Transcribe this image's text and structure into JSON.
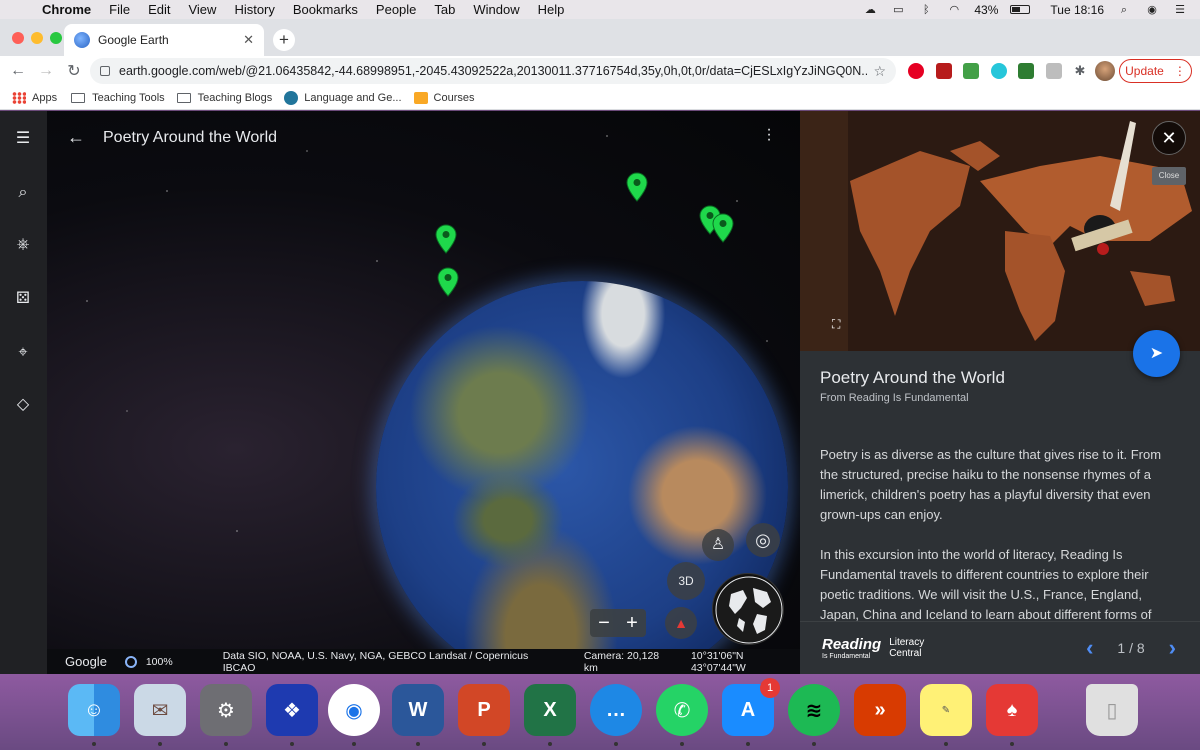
{
  "menubar": {
    "app_name": "Chrome",
    "items": [
      "File",
      "Edit",
      "View",
      "History",
      "Bookmarks",
      "People",
      "Tab",
      "Window",
      "Help"
    ],
    "battery": "43%",
    "clock": "Tue 18:16"
  },
  "browser": {
    "tab_title": "Google Earth",
    "url": "earth.google.com/web/@21.06435842,-44.68998951,-2045.43092522a,20130011.37716754d,35y,0h,0t,0r/data=CjESLxIgYzJiNGQ0N...",
    "update_label": "Update",
    "bookmarks": [
      "Apps",
      "Teaching Tools",
      "Teaching Blogs",
      "Language and Ge...",
      "Courses"
    ]
  },
  "earth": {
    "story_title": "Poetry Around the World",
    "status": {
      "logo": "Google",
      "load_percent": "100%",
      "data_credits": "Data SIO, NOAA, U.S. Navy, NGA, GEBCO  Landsat / Copernicus  IBCAO",
      "camera": "Camera: 20,128 km",
      "coordinates": "10°31'06\"N 43°07'44\"W"
    },
    "btn_3d": "3D"
  },
  "panel": {
    "close_tooltip": "Close",
    "title": "Poetry Around the World",
    "subtitle": "From Reading Is Fundamental",
    "paragraphs": [
      "Poetry is as diverse as the culture that gives rise to it. From the structured, precise haiku to the nonsense rhymes of a limerick, children's poetry has a playful diversity that even grown-ups can enjoy.",
      "In this excursion into the world of literacy, Reading Is Fundamental travels to different countries to explore their poetic traditions. We will visit the U.S., France, England, Japan, China and Iceland to learn about different forms of poetry."
    ],
    "logo_reading": "Reading",
    "logo_rif": "Is Fundamental",
    "logo_literacy_1": "Literacy",
    "logo_literacy_2": "Central",
    "page_indicator": "1 / 8"
  },
  "dock": {
    "app_store_badge": "1",
    "apps": [
      "finder-icon",
      "mail-icon",
      "system-preferences-icon",
      "dropbox-icon",
      "chrome-icon",
      "word-icon",
      "powerpoint-icon",
      "excel-icon",
      "messages-icon",
      "whatsapp-icon",
      "app-store-icon",
      "spotify-icon",
      "remote-desktop-icon",
      "stickies-icon",
      "acrobat-icon",
      "trash-icon"
    ]
  }
}
